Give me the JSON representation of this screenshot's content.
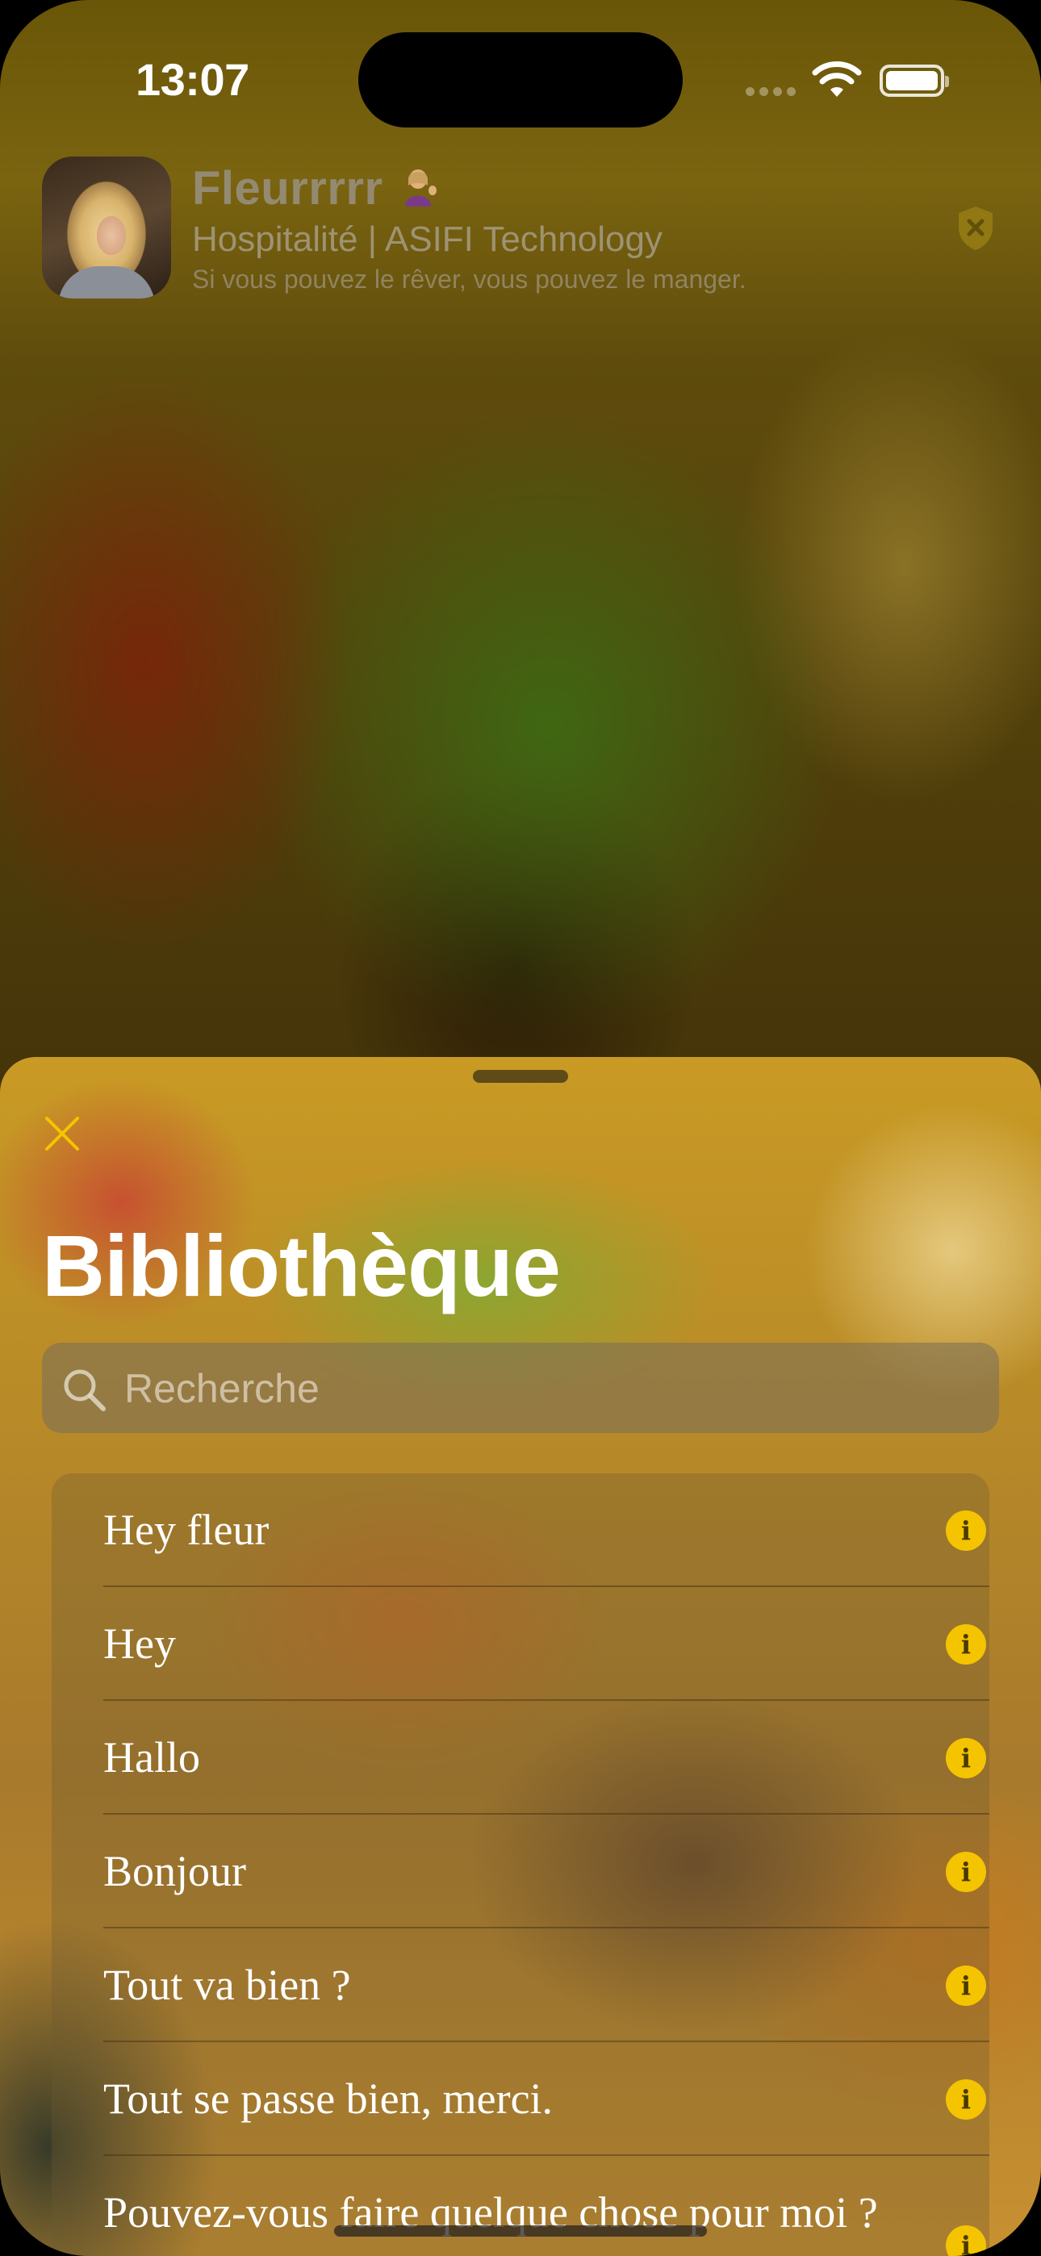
{
  "status_bar": {
    "time": "13:07",
    "icons": [
      "cellular-signal-icon",
      "wifi-icon",
      "battery-icon"
    ]
  },
  "profile": {
    "name": "Fleurrrrr",
    "emoji": "person-tipping-hand-emoji",
    "subtitle": "Hospitalité | ASIFI Technology",
    "tagline": "Si vous pouvez le rêver, vous pouvez le manger.",
    "badge_icon": "shield-x-icon"
  },
  "sheet": {
    "close_icon": "close-x-icon",
    "title": "Bibliothèque",
    "search": {
      "placeholder": "Recherche",
      "value": ""
    },
    "items": [
      {
        "label": "Hey fleur"
      },
      {
        "label": "Hey"
      },
      {
        "label": "Hallo"
      },
      {
        "label": "Bonjour"
      },
      {
        "label": "Tout va bien ?"
      },
      {
        "label": "Tout se passe bien, merci."
      },
      {
        "label": "Pouvez-vous faire quelque chose pour moi ?"
      }
    ],
    "info_glyph": "i"
  },
  "colors": {
    "accent": "#F5C400",
    "title_text": "#FFFFFF"
  }
}
